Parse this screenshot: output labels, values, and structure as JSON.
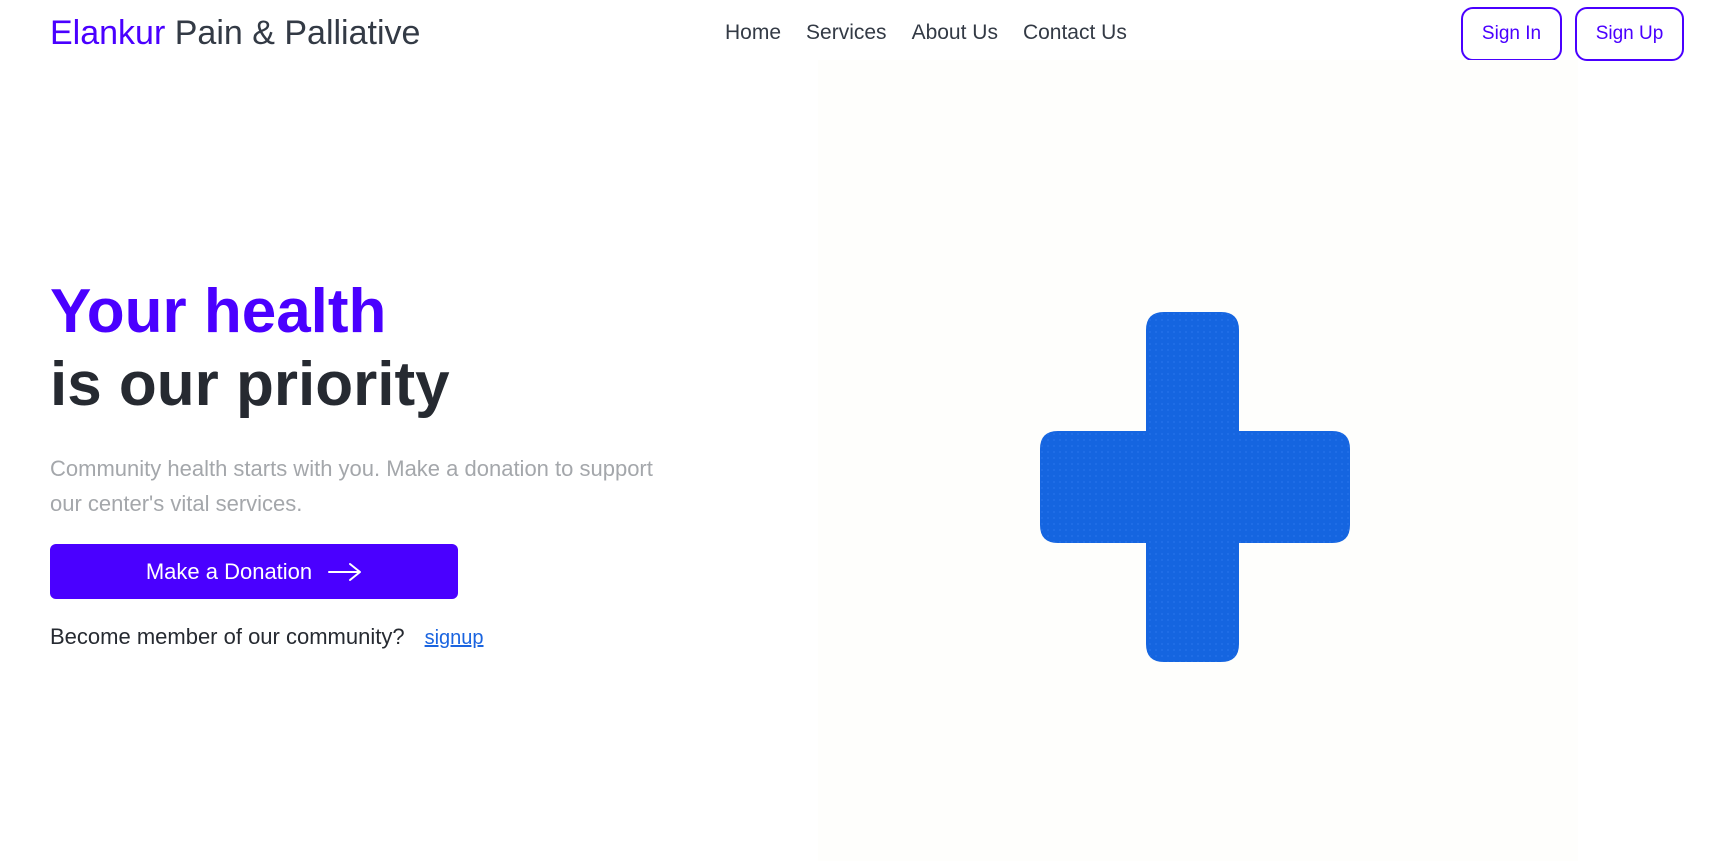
{
  "brand": {
    "accent": "Elankur",
    "rest": "Pain & Palliative"
  },
  "nav": {
    "items": [
      {
        "label": "Home"
      },
      {
        "label": "Services"
      },
      {
        "label": "About Us"
      },
      {
        "label": "Contact Us"
      }
    ]
  },
  "auth": {
    "sign_in_label": "Sign In",
    "sign_up_label": "Sign Up"
  },
  "hero": {
    "headline_accent": "Your health",
    "headline_rest": "is our priority",
    "subtext": "Community health starts with you. Make a donation to support our center's vital services.",
    "donate_label": "Make a Donation",
    "donate_icon": "arrow-right-icon",
    "member_prompt": "Become member of our community?",
    "signup_link_label": "signup",
    "image_icon": "medical-cross-icon"
  },
  "colors": {
    "accent": "#4a00ff",
    "text_dark": "#262a31",
    "text_muted": "#a4a7ab",
    "link": "#1a64e0",
    "cross_blue": "#1565e0"
  }
}
